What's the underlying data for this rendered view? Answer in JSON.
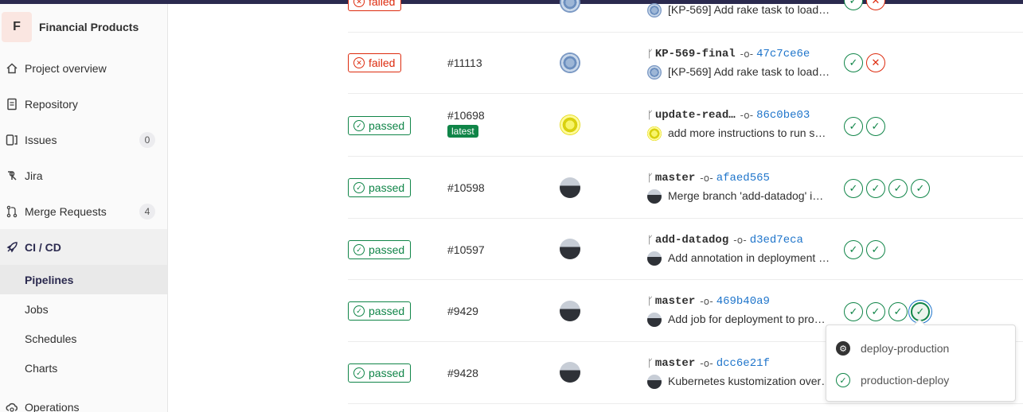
{
  "project": {
    "initial": "F",
    "name": "Financial Products"
  },
  "sidebar": {
    "items": [
      {
        "label": "Project overview",
        "icon": "home-icon"
      },
      {
        "label": "Repository",
        "icon": "doc-text-icon"
      },
      {
        "label": "Issues",
        "icon": "issues-icon",
        "count": "0"
      },
      {
        "label": "Jira",
        "icon": "jira-icon"
      },
      {
        "label": "Merge Requests",
        "icon": "git-merge-icon",
        "count": "4"
      },
      {
        "label": "CI / CD",
        "icon": "rocket-icon"
      },
      {
        "label": "Operations",
        "icon": "cloud-gear-icon"
      }
    ],
    "cicd_sub": [
      "Pipelines",
      "Jobs",
      "Schedules",
      "Charts"
    ]
  },
  "pipelines": [
    {
      "status": "failed",
      "id": "#11113",
      "branch": "KP-569-final",
      "sha": "47c7ce6e",
      "message": "[KP-569] Add rake task to load…",
      "avatar": "blue",
      "stages": [
        "ok",
        "fail"
      ]
    },
    {
      "status": "passed",
      "id": "#10698",
      "latest": "latest",
      "branch": "update-read…",
      "sha": "86c0be03",
      "message": "add more instructions to run s…",
      "avatar": "yellow",
      "stages": [
        "ok",
        "ok"
      ]
    },
    {
      "status": "passed",
      "id": "#10598",
      "branch": "master",
      "sha": "afaed565",
      "message": "Merge branch 'add-datadog' i…",
      "avatar": "dark",
      "stages": [
        "ok",
        "ok",
        "ok",
        "ok"
      ]
    },
    {
      "status": "passed",
      "id": "#10597",
      "branch": "add-datadog",
      "sha": "d3ed7eca",
      "message": "Add annotation in deployment …",
      "avatar": "dark",
      "stages": [
        "ok",
        "ok"
      ]
    },
    {
      "status": "passed",
      "id": "#9429",
      "branch": "master",
      "sha": "469b40a9",
      "message": "Add job for deployment to pro…",
      "avatar": "dark",
      "stages": [
        "ok",
        "ok",
        "ok",
        "focus"
      ]
    },
    {
      "status": "passed",
      "id": "#9428",
      "branch": "master",
      "sha": "dcc6e21f",
      "message": "Kubernetes kustomization over…",
      "avatar": "dark",
      "stages": []
    }
  ],
  "top_partial": {
    "status": "failed",
    "message": "[KP-569] Add rake task to load…"
  },
  "dropdown": {
    "items": [
      {
        "label": "deploy-production",
        "icon": "gear-icon"
      },
      {
        "label": "production-deploy",
        "icon": "status-success-icon"
      }
    ]
  },
  "colors": {
    "success": "#108548",
    "failed": "#dd2b0e",
    "link": "#1f75cb",
    "nav_active": "#2b2a4f"
  }
}
